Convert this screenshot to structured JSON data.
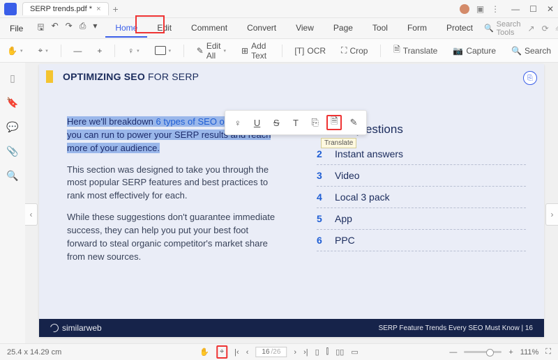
{
  "app": {
    "tab_title": "SERP trends.pdf *"
  },
  "menu": {
    "file": "File",
    "tabs": [
      "Home",
      "Edit",
      "Comment",
      "Convert",
      "View",
      "Page",
      "Tool",
      "Form",
      "Protect"
    ],
    "active": 0,
    "search_placeholder": "Search Tools"
  },
  "toolbar": {
    "edit_all": "Edit All",
    "add_text": "Add Text",
    "ocr": "OCR",
    "crop": "Crop",
    "translate": "Translate",
    "capture": "Capture",
    "search": "Search"
  },
  "doc": {
    "section_title_bold": "OPTIMIZING SEO",
    "section_title_rest": " FOR SERP",
    "p1_a": "Here we'll breakdown ",
    "p1_link": "6 types of SEO optimizations",
    "p1_b": " you can run to power your SERP results and reach more of your audience.",
    "p2": "This section was designed to take you through the most popular SERP features and best practices to rank most effectively for each.",
    "p3": "While these suggestions don't guarantee immediate success, they can help you put your best foot forward to steal organic competitor's market share from new sources.",
    "rq_title": "elated questions",
    "rq": [
      {
        "n": "2",
        "t": "Instant answers"
      },
      {
        "n": "3",
        "t": "Video"
      },
      {
        "n": "4",
        "t": "Local 3 pack"
      },
      {
        "n": "5",
        "t": "App"
      },
      {
        "n": "6",
        "t": "PPC"
      }
    ],
    "footer_brand": "similarweb",
    "footer_right": "SERP Feature Trends Every SEO Must Know |   16"
  },
  "float": {
    "tooltip": "Translate"
  },
  "status": {
    "dim": "25.4 x 14.29 cm",
    "page_current": "16",
    "page_total": "/26",
    "zoom": "111%"
  }
}
